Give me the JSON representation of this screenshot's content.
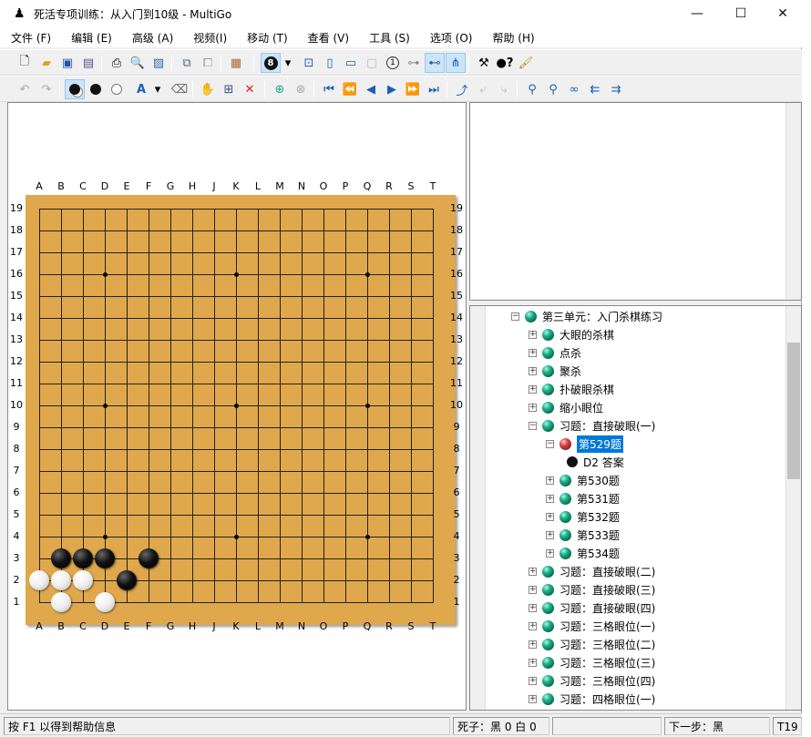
{
  "window": {
    "title": "死活专项训练：从入门到10级 - MultiGo",
    "minimize": "—",
    "maximize": "☐",
    "close": "✕"
  },
  "menu": [
    "文件 (F)",
    "编辑 (E)",
    "高级 (A)",
    "视频(I)",
    "移动 (T)",
    "查看 (V)",
    "工具 (S)",
    "选项 (O)",
    "帮助 (H)"
  ],
  "board": {
    "columns": [
      "A",
      "B",
      "C",
      "D",
      "E",
      "F",
      "G",
      "H",
      "J",
      "K",
      "L",
      "M",
      "N",
      "O",
      "P",
      "Q",
      "R",
      "S",
      "T"
    ],
    "rows": [
      "19",
      "18",
      "17",
      "16",
      "15",
      "14",
      "13",
      "12",
      "11",
      "10",
      "9",
      "8",
      "7",
      "6",
      "5",
      "4",
      "3",
      "2",
      "1"
    ],
    "stones": [
      {
        "color": "black",
        "point": "B3"
      },
      {
        "color": "black",
        "point": "C3"
      },
      {
        "color": "black",
        "point": "D3"
      },
      {
        "color": "black",
        "point": "F3"
      },
      {
        "color": "black",
        "point": "E2"
      },
      {
        "color": "white",
        "point": "A2"
      },
      {
        "color": "white",
        "point": "B2"
      },
      {
        "color": "white",
        "point": "C2"
      },
      {
        "color": "white",
        "point": "B1"
      },
      {
        "color": "white",
        "point": "D1"
      }
    ]
  },
  "tree": [
    {
      "label": "第三单元：入门杀棋练习",
      "level": 0,
      "expander": "−",
      "icon": "ball"
    },
    {
      "label": "大眼的杀棋",
      "level": 1,
      "expander": "+",
      "icon": "ball"
    },
    {
      "label": "点杀",
      "level": 1,
      "expander": "+",
      "icon": "ball"
    },
    {
      "label": "聚杀",
      "level": 1,
      "expander": "+",
      "icon": "ball"
    },
    {
      "label": "扑破眼杀棋",
      "level": 1,
      "expander": "+",
      "icon": "ball"
    },
    {
      "label": "缩小眼位",
      "level": 1,
      "expander": "+",
      "icon": "ball"
    },
    {
      "label": "习题：直接破眼(一)",
      "level": 1,
      "expander": "−",
      "icon": "ball"
    },
    {
      "label": "第529题",
      "level": 2,
      "expander": "−",
      "icon": "ball-red",
      "selected": true
    },
    {
      "label": "D2 答案",
      "level": 3,
      "expander": "",
      "icon": "black-stone"
    },
    {
      "label": "第530题",
      "level": 2,
      "expander": "+",
      "icon": "ball"
    },
    {
      "label": "第531题",
      "level": 2,
      "expander": "+",
      "icon": "ball"
    },
    {
      "label": "第532题",
      "level": 2,
      "expander": "+",
      "icon": "ball"
    },
    {
      "label": "第533题",
      "level": 2,
      "expander": "+",
      "icon": "ball"
    },
    {
      "label": "第534题",
      "level": 2,
      "expander": "+",
      "icon": "ball"
    },
    {
      "label": "习题：直接破眼(二)",
      "level": 1,
      "expander": "+",
      "icon": "ball"
    },
    {
      "label": "习题：直接破眼(三)",
      "level": 1,
      "expander": "+",
      "icon": "ball"
    },
    {
      "label": "习题：直接破眼(四)",
      "level": 1,
      "expander": "+",
      "icon": "ball"
    },
    {
      "label": "习题：三格眼位(一)",
      "level": 1,
      "expander": "+",
      "icon": "ball"
    },
    {
      "label": "习题：三格眼位(二)",
      "level": 1,
      "expander": "+",
      "icon": "ball"
    },
    {
      "label": "习题：三格眼位(三)",
      "level": 1,
      "expander": "+",
      "icon": "ball"
    },
    {
      "label": "习题：三格眼位(四)",
      "level": 1,
      "expander": "+",
      "icon": "ball"
    },
    {
      "label": "习题：四格眼位(一)",
      "level": 1,
      "expander": "+",
      "icon": "ball"
    }
  ],
  "status": {
    "help": "按 F1 以得到帮助信息",
    "captured": "死子：黑 0 白 0",
    "empty": "",
    "next": "下一步：黑",
    "extra": "T19"
  }
}
